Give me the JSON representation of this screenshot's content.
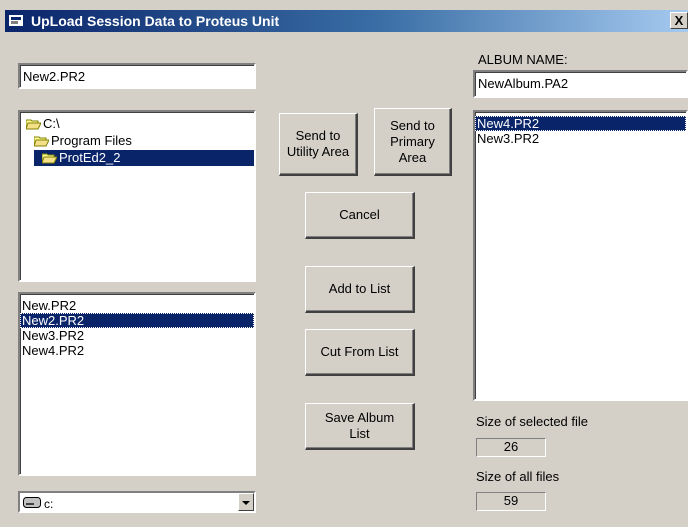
{
  "window": {
    "title": "UpLoad Session Data to Proteus Unit",
    "close_label": "X"
  },
  "filename_field": {
    "value": "New2.PR2"
  },
  "album": {
    "label": "ALBUM NAME:",
    "value": "NewAlbum.PA2"
  },
  "dir_tree": {
    "items": [
      {
        "label": "C:\\",
        "level": 0,
        "selected": false
      },
      {
        "label": "Program Files",
        "level": 1,
        "selected": false
      },
      {
        "label": "ProtEd2_2",
        "level": 2,
        "selected": true
      }
    ]
  },
  "file_list": {
    "items": [
      "New.PR2",
      "New2.PR2",
      "New3.PR2",
      "New4.PR2"
    ],
    "selected_index": 1
  },
  "album_list": {
    "items": [
      "New4.PR2",
      "New3.PR2"
    ],
    "selected_index": 0
  },
  "buttons": {
    "send_utility": "Send to\nUtility Area",
    "send_primary": "Send to\nPrimary\nArea",
    "cancel": "Cancel",
    "add_to_list": "Add to List",
    "cut_from_list": "Cut From List",
    "save_album_list": "Save Album\nList"
  },
  "size_selected": {
    "label": "Size of selected file",
    "value": "26"
  },
  "size_all": {
    "label": "Size of all files",
    "value": "59"
  },
  "drive": {
    "value": "c:"
  },
  "colors": {
    "title_start": "#0a246a",
    "title_end": "#a6caf0",
    "selection": "#0a246a",
    "face": "#d4d0c8"
  }
}
